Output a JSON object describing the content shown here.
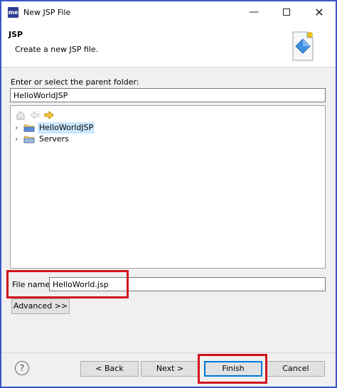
{
  "window": {
    "app_logo": "me",
    "title": "New JSP File",
    "minimize_glyph": "—",
    "close_glyph": "✕"
  },
  "banner": {
    "title": "JSP",
    "description": "Create a new JSP file.",
    "icon": "jsp-wizard-icon"
  },
  "parent": {
    "label": "Enter or select the parent folder:",
    "value": "HelloWorldJSP"
  },
  "tree": {
    "toolbar_icons": [
      "home-icon",
      "back-arrow-icon",
      "forward-arrow-icon"
    ],
    "items": [
      {
        "label": "HelloWorldJSP",
        "icon": "project-folder-icon",
        "selected": true
      },
      {
        "label": "Servers",
        "icon": "folder-icon",
        "selected": false
      }
    ]
  },
  "file_name": {
    "label": "File name:",
    "value": "HelloWorld.jsp"
  },
  "buttons": {
    "advanced": "Advanced >>",
    "help": "?",
    "back": "< Back",
    "next": "Next >",
    "finish": "Finish",
    "cancel": "Cancel"
  },
  "colors": {
    "highlight": "#d0141e",
    "selection": "#cce8ff",
    "frame": "#3b55c9"
  }
}
